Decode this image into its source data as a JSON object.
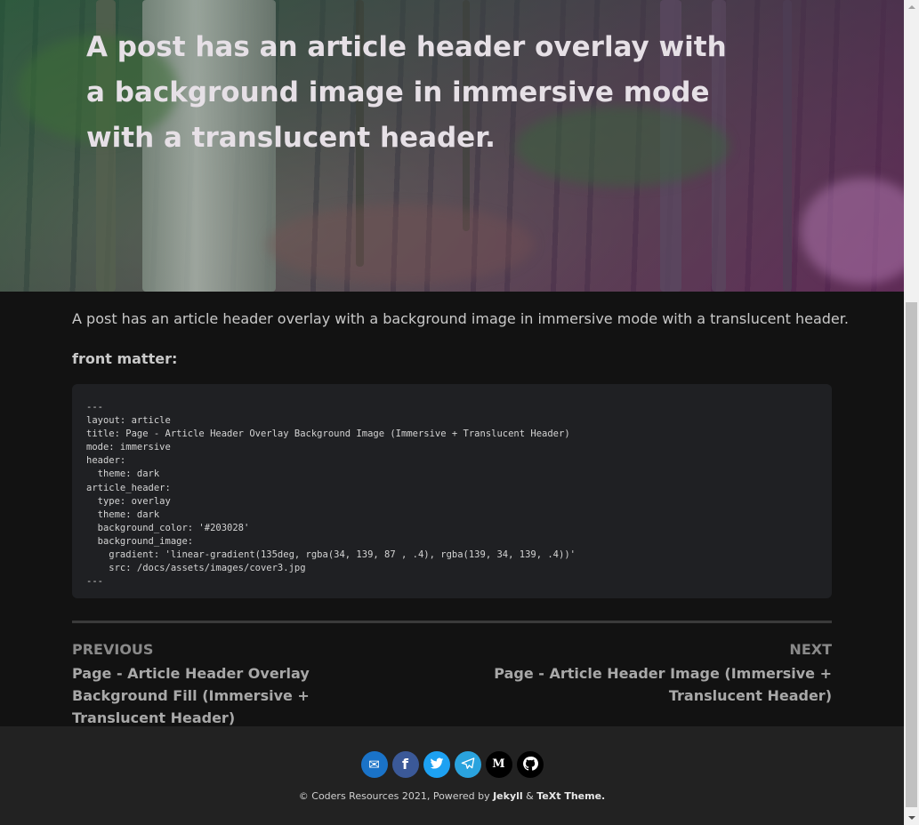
{
  "article": {
    "title": "A post has an article header overlay with a background image in immersive mode with a translucent header.",
    "intro": "A post has an article header overlay with a background image in immersive mode with a translucent header.",
    "front_matter_label": "front matter:",
    "code_lines": [
      "---",
      "layout: article",
      "title: Page - Article Header Overlay Background Image (Immersive + Translucent Header)",
      "mode: immersive",
      "header:",
      "  theme: dark",
      "article_header:",
      "  type: overlay",
      "  theme: dark",
      "  background_color: '#203028'",
      "  background_image:",
      "    gradient: 'linear-gradient(135deg, rgba(34, 139, 87 , .4), rgba(139, 34, 139, .4))'",
      "    src: /docs/assets/images/cover3.jpg",
      "---"
    ]
  },
  "nav": {
    "previous_label": "PREVIOUS",
    "previous_title": "Page - Article Header Overlay Background Fill (Immersive + Translucent Header)",
    "next_label": "NEXT",
    "next_title": "Page - Article Header Image (Immersive + Translucent Header)"
  },
  "footer": {
    "social": [
      {
        "icon": "envelope-icon",
        "glyph": "✉",
        "color": "#1a73c8"
      },
      {
        "icon": "facebook-icon",
        "glyph": "f",
        "color": "#3b5998"
      },
      {
        "icon": "twitter-icon",
        "glyph": "t",
        "color": "#1da1f2"
      },
      {
        "icon": "telegram-icon",
        "glyph": "➤",
        "color": "#2aa3de"
      },
      {
        "icon": "medium-icon",
        "glyph": "M",
        "color": "#000000"
      },
      {
        "icon": "github-icon",
        "glyph": "◉",
        "color": "#000000"
      }
    ],
    "copyright_prefix": "© Coders Resources 2021, Powered by ",
    "jekyll": "Jekyll",
    "amp": " & ",
    "theme": "TeXt Theme."
  }
}
